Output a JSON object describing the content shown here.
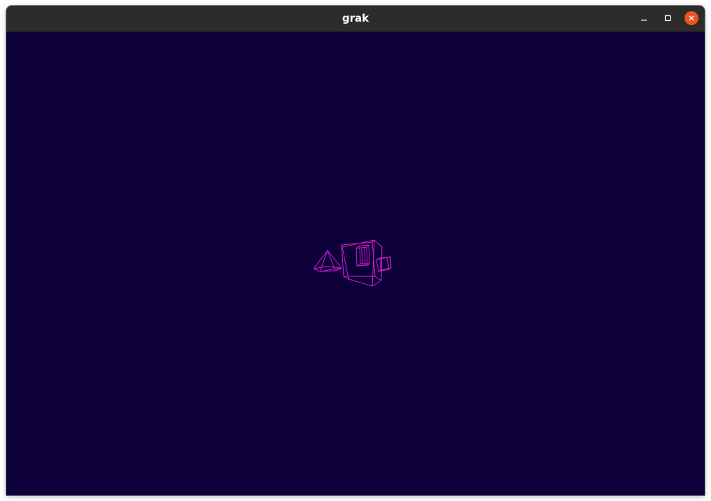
{
  "window": {
    "title": "grak"
  },
  "controls": {
    "minimize_icon": "minimize-icon",
    "maximize_icon": "maximize-icon",
    "close_icon": "close-icon"
  },
  "colors": {
    "titlebar": "#2c2c2c",
    "viewport_background": "#0d0038",
    "wireframe": "#d21ed2",
    "close_button": "#e95420"
  }
}
